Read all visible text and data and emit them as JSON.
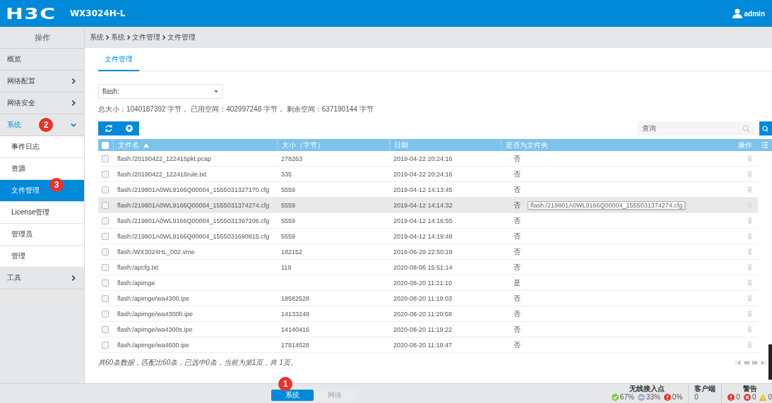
{
  "header": {
    "logo": "H3C",
    "model": "WX3024H-L",
    "user": "admin"
  },
  "sidebar": {
    "title": "操作",
    "items": [
      {
        "label": "概览",
        "kind": "plain",
        "selected": false
      },
      {
        "label": "网络配置",
        "kind": "group",
        "expanded": false,
        "selected": false
      },
      {
        "label": "网络安全",
        "kind": "group",
        "expanded": false,
        "selected": false
      },
      {
        "label": "系统",
        "kind": "group",
        "expanded": true,
        "selected": false,
        "badge": "2",
        "children": [
          {
            "label": "事件日志",
            "selected": false
          },
          {
            "label": "资源",
            "selected": false
          },
          {
            "label": "文件管理",
            "selected": true,
            "badge": "3"
          },
          {
            "label": "License管理",
            "selected": false
          },
          {
            "label": "管理员",
            "selected": false
          },
          {
            "label": "管理",
            "selected": false
          }
        ]
      },
      {
        "label": "工具",
        "kind": "group",
        "expanded": false,
        "selected": false
      }
    ]
  },
  "breadcrumb": [
    "系统",
    "系统",
    "文件管理",
    "文件管理"
  ],
  "tabs": [
    {
      "label": "文件管理",
      "selected": true
    }
  ],
  "storage": {
    "value": "flash:"
  },
  "space_info": "总大小：1040187392 字节， 已用空间：402997248 字节， 剩余空间：637190144 字节",
  "search": {
    "placeholder": "查询"
  },
  "table": {
    "all_checked": false,
    "columns": [
      {
        "label": "文件名",
        "sorted_ascending": true
      },
      {
        "label": "大小（字节）"
      },
      {
        "label": "日期"
      },
      {
        "label": "是否为文件夹"
      },
      {
        "label": "操作"
      }
    ],
    "rows": [
      {
        "name": "flash:/20190422_122416pkt.pcap",
        "size": "278263",
        "date": "2019-04-22 20:24:16",
        "folder": "否",
        "checked": false,
        "hovered": false
      },
      {
        "name": "flash:/20190422_122416rule.txt",
        "size": "335",
        "date": "2019-04-22 20:24:16",
        "folder": "否",
        "checked": false,
        "hovered": false
      },
      {
        "name": "flash:/219801A0WL9166Q00004_1555031327170.cfg",
        "size": "5559",
        "date": "2019-04-12 14:13:45",
        "folder": "否",
        "checked": false,
        "hovered": false
      },
      {
        "name": "flash:/219801A0WL9166Q00004_1555031374274.cfg",
        "size": "5559",
        "date": "2019-04-12 14:14:32",
        "folder": "否",
        "checked": false,
        "hovered": true,
        "tooltip": "flash:/219801A0WL9166Q00004_1555031374274.cfg"
      },
      {
        "name": "flash:/219801A0WL9166Q00004_1555031397206.cfg",
        "size": "5559",
        "date": "2019-04-12 14:16:55",
        "folder": "否",
        "checked": false,
        "hovered": false
      },
      {
        "name": "flash:/219801A0WL9166Q00004_1555031690815.cfg",
        "size": "5559",
        "date": "2019-04-12 14:19:48",
        "folder": "否",
        "checked": false,
        "hovered": false
      },
      {
        "name": "flash:/WX3024HL_002.vme",
        "size": "182152",
        "date": "2016-06-29 22:50:19",
        "folder": "否",
        "checked": false,
        "hovered": false
      },
      {
        "name": "flash:/apcfg.txt",
        "size": "119",
        "date": "2020-08-06 15:51:14",
        "folder": "否",
        "checked": false,
        "hovered": false
      },
      {
        "name": "flash:/apimge",
        "date": "2020-08-20 11:21:10",
        "folder": "是",
        "checked": false,
        "hovered": false
      },
      {
        "name": "flash:/apimge/wa4300.ipe",
        "size": "18582528",
        "date": "2020-08-20 11:19:03",
        "folder": "否",
        "checked": false,
        "hovered": false
      },
      {
        "name": "flash:/apimge/wa4300h.ipe",
        "size": "14133248",
        "date": "2020-08-20 11:20:58",
        "folder": "否",
        "checked": false,
        "hovered": false
      },
      {
        "name": "flash:/apimge/wa4300s.ipe",
        "size": "14140416",
        "date": "2020-08-20 11:19:22",
        "folder": "否",
        "checked": false,
        "hovered": false
      },
      {
        "name": "flash:/apimge/wa4600.ipe",
        "size": "17814528",
        "date": "2020-08-20 11:19:47",
        "folder": "否",
        "checked": false,
        "hovered": false
      }
    ]
  },
  "summary": "共60条数据，匹配出60条，已选中0条，当前为第1页，共 1页。",
  "bottom_tabs": [
    {
      "label": "系统",
      "selected": true,
      "badge": "1"
    },
    {
      "label": "网络",
      "selected": false
    }
  ],
  "status": [
    {
      "title": "无线接入点",
      "items": [
        {
          "kind": "ok",
          "value": "67%",
          "color": "#8cc63f"
        },
        {
          "kind": "minus",
          "value": "33%",
          "color": "#9fb3c8"
        },
        {
          "kind": "alert",
          "value": "0%",
          "color": "#e53935"
        }
      ]
    },
    {
      "title": "客户端",
      "items": [
        {
          "kind": "plain",
          "value": "0"
        }
      ]
    },
    {
      "title": "警告",
      "items": [
        {
          "kind": "alert",
          "value": "0",
          "color": "#e53935"
        },
        {
          "kind": "error",
          "value": "0",
          "color": "#e53935"
        },
        {
          "kind": "warning",
          "value": "0",
          "color": "#f5b400"
        }
      ]
    }
  ]
}
